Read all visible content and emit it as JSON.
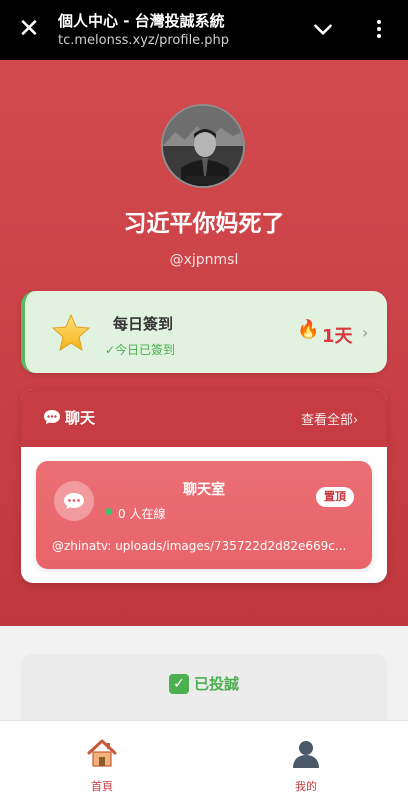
{
  "browser": {
    "page_title": "個人中心 - 台灣投誠系統",
    "url": "tc.melonss.xyz/profile.php"
  },
  "profile": {
    "display_name": "习近平你妈死了",
    "handle": "@xjpnmsl"
  },
  "checkin": {
    "title": "每日簽到",
    "status": "✓今日已簽到",
    "streak": "1天"
  },
  "chat": {
    "title": "聊天",
    "view_all": "查看全部›",
    "room": {
      "name": "聊天室",
      "online": "0 人在線",
      "pin_badge": "置頂",
      "last_message": "@zhinatv: uploads/images/735722d2d82e669c..."
    }
  },
  "status_card": {
    "text": "已投誠"
  },
  "bottom_nav": {
    "home_label": "首頁",
    "me_label": "我的"
  },
  "colors": {
    "brand_red": "#c73c42",
    "success_green": "#4caf50"
  }
}
